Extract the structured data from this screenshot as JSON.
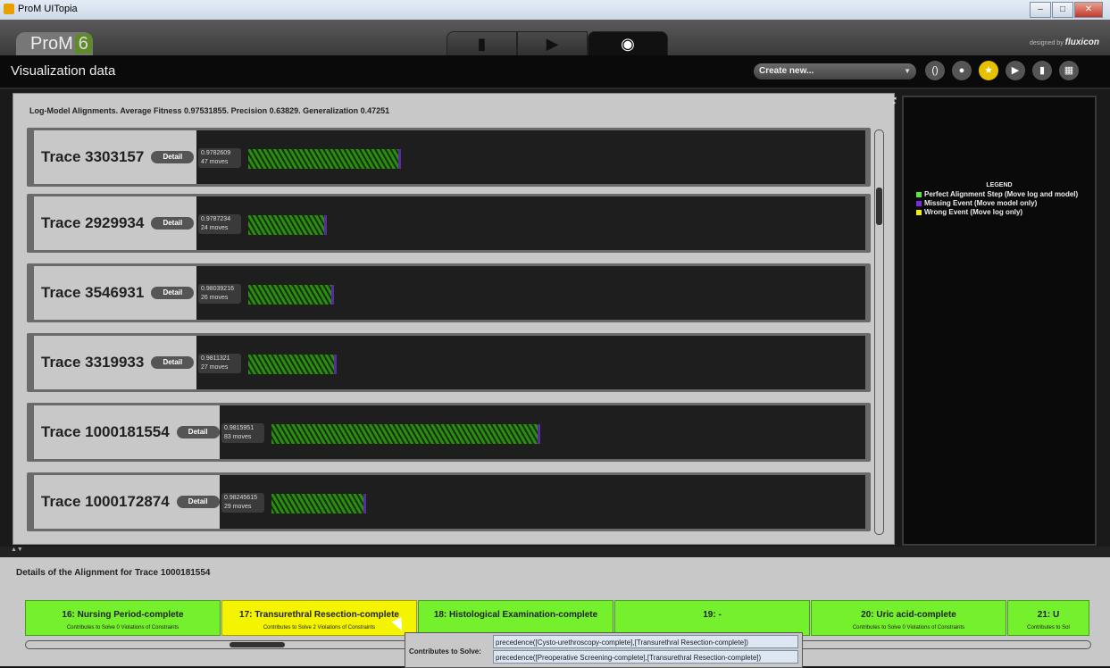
{
  "window": {
    "title": "ProM UITopia",
    "minimize": "–",
    "maximize": "□",
    "close": "✕"
  },
  "header": {
    "logo_text": "ProM",
    "logo_version": "6",
    "tabs": [
      {
        "icon": "document-icon",
        "glyph": "▮"
      },
      {
        "icon": "play-icon",
        "glyph": "▶"
      },
      {
        "icon": "eye-icon",
        "glyph": "◉"
      }
    ],
    "designed_by": "designed by",
    "brand": "fluxicon"
  },
  "viewbar": {
    "title": "Visualization data",
    "create_select": "Create new...",
    "icons": [
      {
        "name": "refresh-icon",
        "glyph": "()"
      },
      {
        "name": "drop-icon",
        "glyph": "●"
      },
      {
        "name": "star-icon",
        "glyph": "★"
      },
      {
        "name": "play-icon",
        "glyph": "▶"
      },
      {
        "name": "copy-icon",
        "glyph": "▮"
      },
      {
        "name": "grid-icon",
        "glyph": "▦"
      }
    ]
  },
  "main": {
    "summary": "Log-Model Alignments. Average Fitness 0.97531855. Precision 0.63829. Generalization 0.47251",
    "detail_label": "Detail",
    "traces": [
      {
        "name": "Trace 3303157",
        "fitness": "0.9782609",
        "moves": "47 moves",
        "moves_count": 47
      },
      {
        "name": "Trace 2929934",
        "fitness": "0.9787234",
        "moves": "24 moves",
        "moves_count": 24
      },
      {
        "name": "Trace 3546931",
        "fitness": "0.98039216",
        "moves": "26 moves",
        "moves_count": 26
      },
      {
        "name": "Trace 3319933",
        "fitness": "0.9811321",
        "moves": "27 moves",
        "moves_count": 27
      },
      {
        "name": "Trace 1000181554",
        "fitness": "0.9815951",
        "moves": "83 moves",
        "moves_count": 83
      },
      {
        "name": "Trace 1000172874",
        "fitness": "0.98245615",
        "moves": "29 moves",
        "moves_count": 29
      }
    ]
  },
  "legend": {
    "title": "LEGEND",
    "items": [
      {
        "label": "Perfect Alignment Step (Move log and model)",
        "color": "#5ae63a"
      },
      {
        "label": "Missing Event (Move model only)",
        "color": "#7a2ae0"
      },
      {
        "label": "Wrong Event (Move log only)",
        "color": "#f0f000"
      }
    ]
  },
  "details": {
    "title": "Details of the Alignment for Trace 1000181554",
    "steps": [
      {
        "title": "16: Nursing Period-complete",
        "sub": "Contributes to Solve 0 Violations of Constraints",
        "color": "green"
      },
      {
        "title": "17: Transurethral Resection-complete",
        "sub": "Contributes to Solve 2 Violations of Constraints",
        "color": "yellow"
      },
      {
        "title": "18: Histological Examination-complete",
        "sub": "",
        "color": "green"
      },
      {
        "title": "19: -",
        "sub": "",
        "color": "green"
      },
      {
        "title": "20: Uric acid-complete",
        "sub": "Contributes to Solve 0 Violations of Constraints",
        "color": "green"
      },
      {
        "title": "21: U",
        "sub": "Contributes to Sol",
        "color": "green"
      }
    ]
  },
  "tooltip": {
    "label": "Contributes to Solve:",
    "lines": [
      "precedence([Cysto-urethroscopy-complete],[Transurethral Resection-complete])",
      "precedence([Preoperative Screening-complete],[Transurethral Resection-complete])"
    ]
  }
}
